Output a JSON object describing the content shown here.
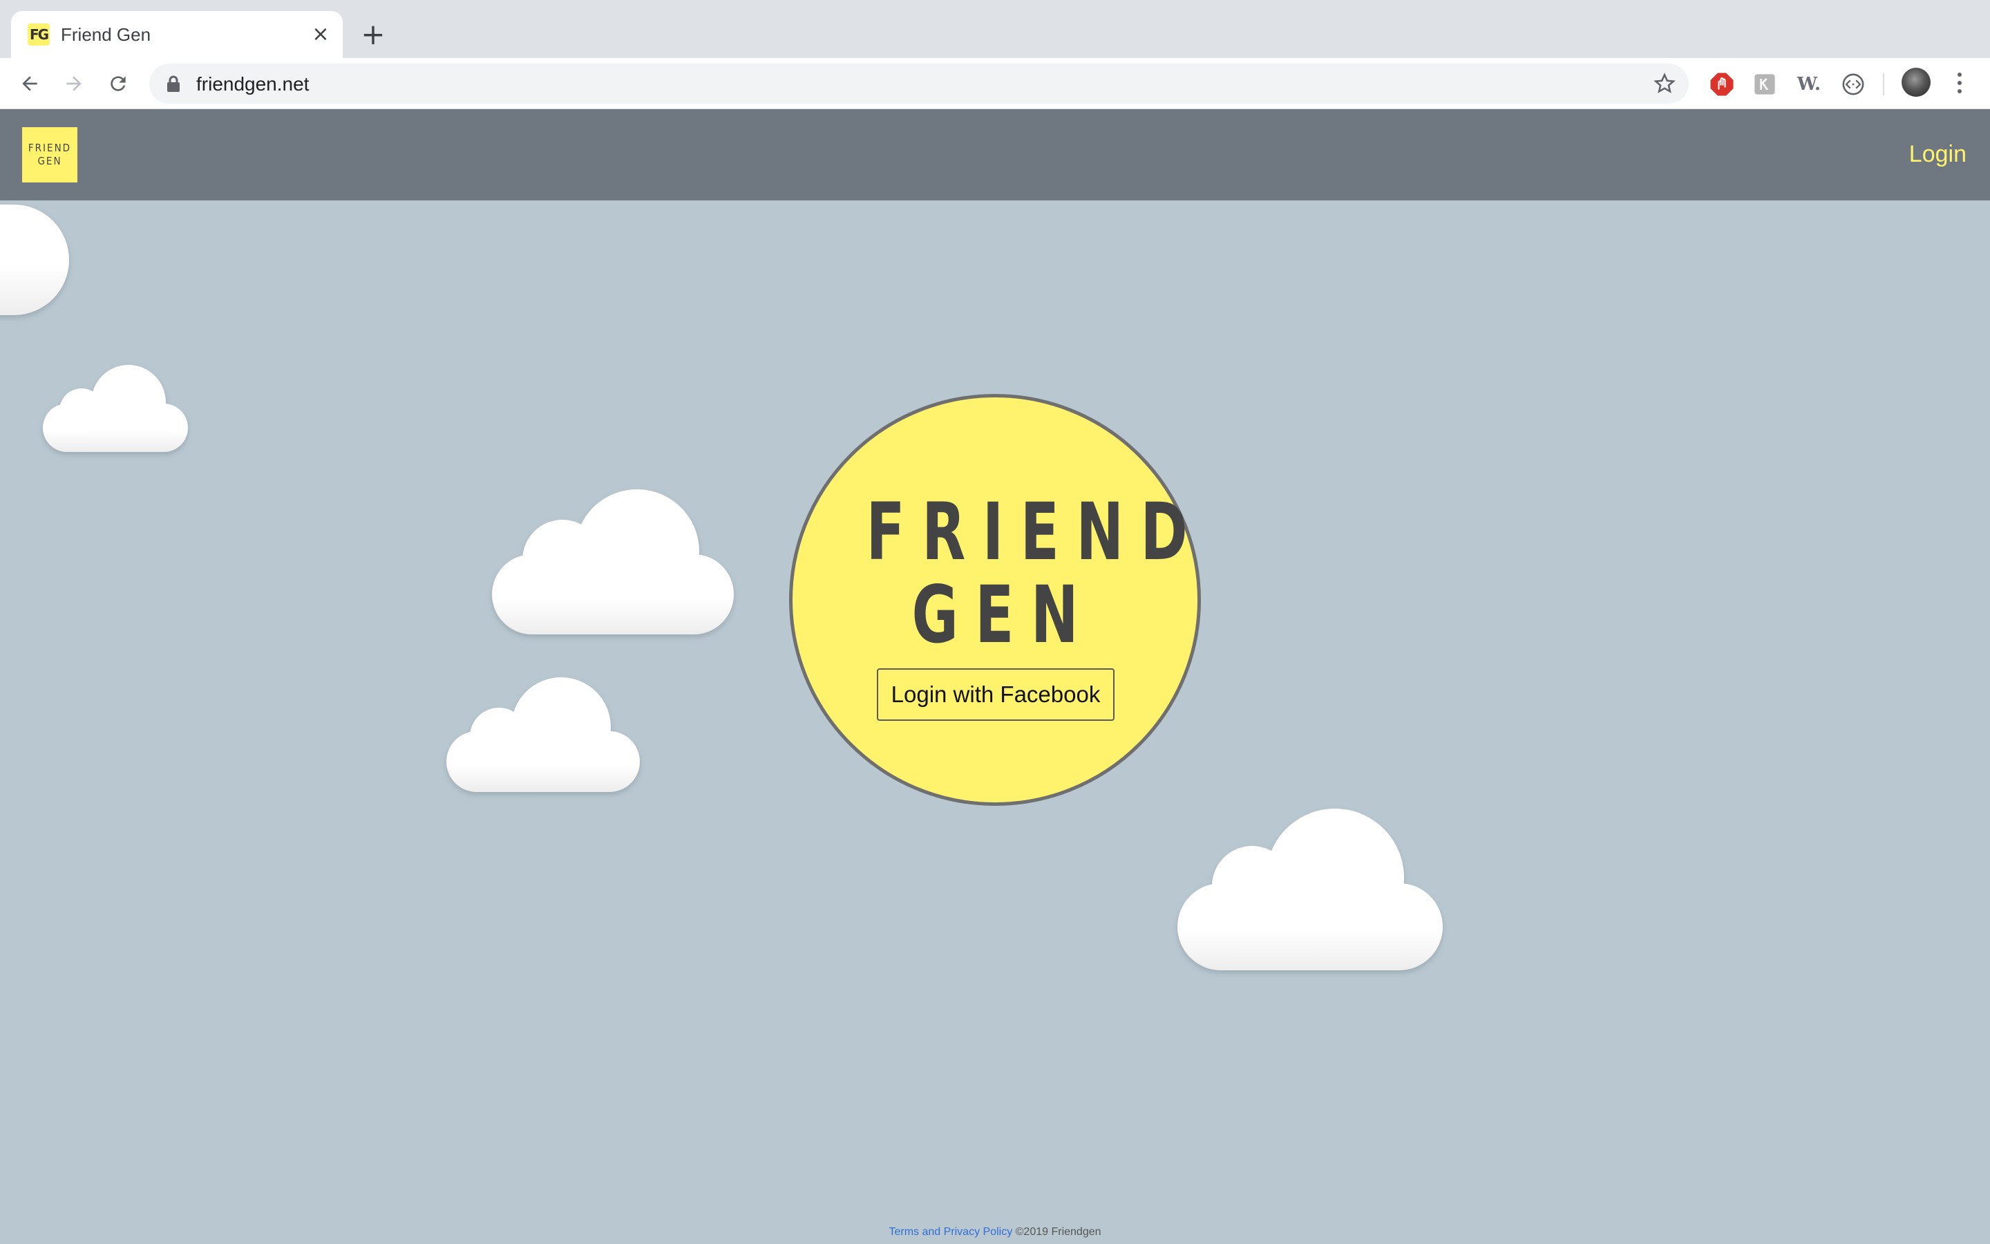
{
  "browser": {
    "tab_title": "Friend Gen",
    "favicon_text": "FG",
    "url": "friendgen.net",
    "icons": [
      "back-icon",
      "forward-icon",
      "reload-icon",
      "lock-icon",
      "star-icon",
      "adblock-icon",
      "extension-icon",
      "w-extension-icon",
      "code-extension-icon",
      "profile-avatar",
      "more-menu-icon"
    ],
    "extension_w_text": "W."
  },
  "header": {
    "logo_line1": "FRIEND",
    "logo_line2": "GEN",
    "login_label": "Login"
  },
  "hero": {
    "title_line1": "FRIEND",
    "title_line2": "GEN",
    "button_label": "Login with Facebook"
  },
  "footer": {
    "terms_link": "Terms and Privacy Policy",
    "copyright": "©2019 Friendgen"
  },
  "colors": {
    "background": "#b9c7d0",
    "header": "#6f7780",
    "accent_yellow": "#fff36d",
    "link_blue": "#2f6fd6"
  }
}
